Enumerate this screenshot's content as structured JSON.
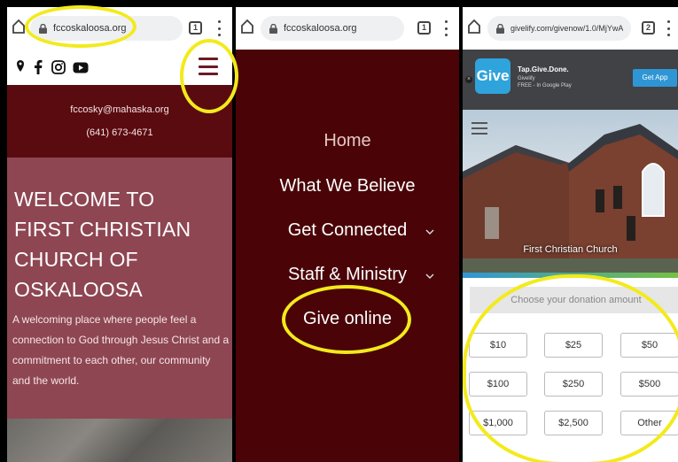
{
  "screens": [
    {
      "browser": {
        "url": "fccoskaloosa.org",
        "tab_count": "1"
      },
      "contact": {
        "email": "fccosky@mahaska.org",
        "phone": "(641) 673-4671"
      },
      "hero": {
        "title_lines": [
          "WELCOME TO",
          "FIRST CHRISTIAN",
          "CHURCH OF",
          "OSKALOOSA"
        ],
        "text": "A welcoming place where people feel a connection to God through Jesus Christ and a commitment to each other, our community and the world."
      },
      "social_icons": [
        "map-pin-icon",
        "facebook-icon",
        "instagram-icon",
        "youtube-icon"
      ]
    },
    {
      "browser": {
        "url": "fccoskaloosa.org",
        "tab_count": "1"
      },
      "nav": {
        "items": [
          "Home",
          "What We Believe",
          "Get Connected",
          "Staff & Ministry",
          "Give online"
        ]
      }
    },
    {
      "browser": {
        "url": "givelify.com/givenow/1.0/MjYwA",
        "tab_count": "2"
      },
      "app_banner": {
        "logo_text": "Give",
        "title": "Tap.Give.Done.",
        "publisher": "Givelify",
        "store_line": "FREE - In Google Play",
        "button": "Get App"
      },
      "church_caption": "First Christian Church",
      "donation": {
        "prompt": "Choose your donation amount",
        "amounts": [
          "$10",
          "$25",
          "$50",
          "$100",
          "$250",
          "$500",
          "$1,000",
          "$2,500",
          "Other"
        ]
      }
    }
  ],
  "colors": {
    "maroon_dark": "#4a0407",
    "maroon": "#5a0b0f",
    "rose": "#8e4652",
    "highlight_yellow": "#f3ea1c",
    "givelify_blue": "#2f96d5"
  }
}
